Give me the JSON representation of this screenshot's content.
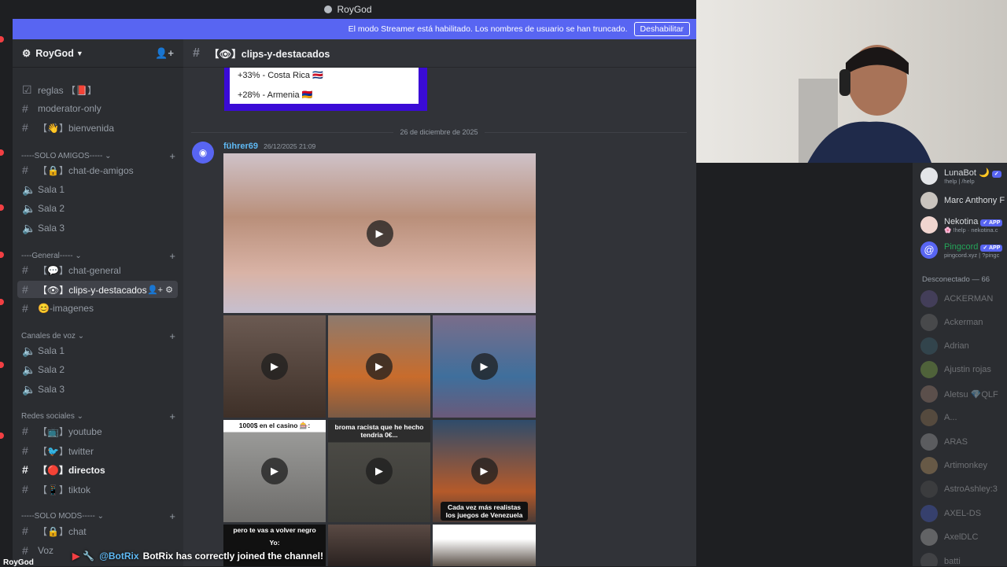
{
  "window": {
    "title": "RoyGod"
  },
  "banner": {
    "text": "El modo Streamer está habilitado. Los nombres de usuario se han truncado.",
    "button": "Deshabilitar"
  },
  "server": {
    "name": "RoyGod"
  },
  "channels": {
    "top": [
      {
        "label": "reglas 【📕】"
      },
      {
        "label": "moderator-only"
      },
      {
        "label": "【👋】bienvenida"
      }
    ],
    "cat1": {
      "label": "-----SOLO AMIGOS-----",
      "items": [
        "【🔒】chat-de-amigos",
        "Sala 1",
        "Sala 2",
        "Sala 3"
      ]
    },
    "cat2": {
      "label": "----General-----",
      "items": [
        "【💬】chat-general",
        "【👁】clips-y-destacados",
        "😊-imagenes"
      ]
    },
    "cat3": {
      "label": "Canales de voz",
      "items": [
        "Sala 1",
        "Sala 2",
        "Sala 3"
      ]
    },
    "cat4": {
      "label": "Redes sociales",
      "items": [
        "【📺】youtube",
        "【🐦】twitter",
        "【🔴】directos",
        "【📱】tiktok"
      ]
    },
    "cat5": {
      "label": "-----SOLO MODS-----",
      "items": [
        "【🔒】chat",
        "Voz"
      ]
    }
  },
  "channel_header": {
    "name": "【👁】clips-y-destacados"
  },
  "embed": {
    "line1": "+33% - Costa Rica 🇨🇷",
    "line2": "+28% - Armenia 🇦🇲"
  },
  "date_divider": "26 de diciembre de 2025",
  "message": {
    "author": "führer69",
    "timestamp": "26/12/2025 21:09"
  },
  "media_captions": {
    "c1": "1000$ en el casino 🎰:",
    "c2": "broma racista que he hecho tendria 0€...",
    "c3": "Cada vez más realistas los juegos de Venezuela",
    "c4": "pero te vas a volver negro",
    "c5": "Yo:"
  },
  "members": {
    "online": [
      {
        "name": "LunaBot 🌙",
        "sub": "!help | /help",
        "color": "#f2f3f5",
        "badge": "✓"
      },
      {
        "name": "Marc Anthony F",
        "sub": "",
        "color": "#dbdee1",
        "badge": ""
      },
      {
        "name": "Nekotina",
        "sub": "🌸 !help · nekotina.c",
        "color": "#dbdee1",
        "badge": "✓ APP"
      },
      {
        "name": "Pingcord",
        "sub": "pingcord.xyz | ?pingc",
        "color": "#23a559",
        "badge": "✓ APP"
      }
    ],
    "offline_header": "Desconectado — 66",
    "offline": [
      "ACKERMAN",
      "Ackerman",
      "Adrian",
      "Ajustin rojas",
      "Aletsu 💎QLF",
      "A...",
      "ARAS",
      "Artimonkey",
      "AstroAshley:3",
      "AXEL-DS",
      "AxelDLC",
      "batti"
    ]
  },
  "ticker": {
    "user": "@BotRix",
    "text": "BotRix has correctly joined the channel!"
  },
  "status_label": "RoyGod",
  "colors": {
    "accent": "#5865f2",
    "sidebar": "#2b2d31",
    "main": "#313338"
  }
}
